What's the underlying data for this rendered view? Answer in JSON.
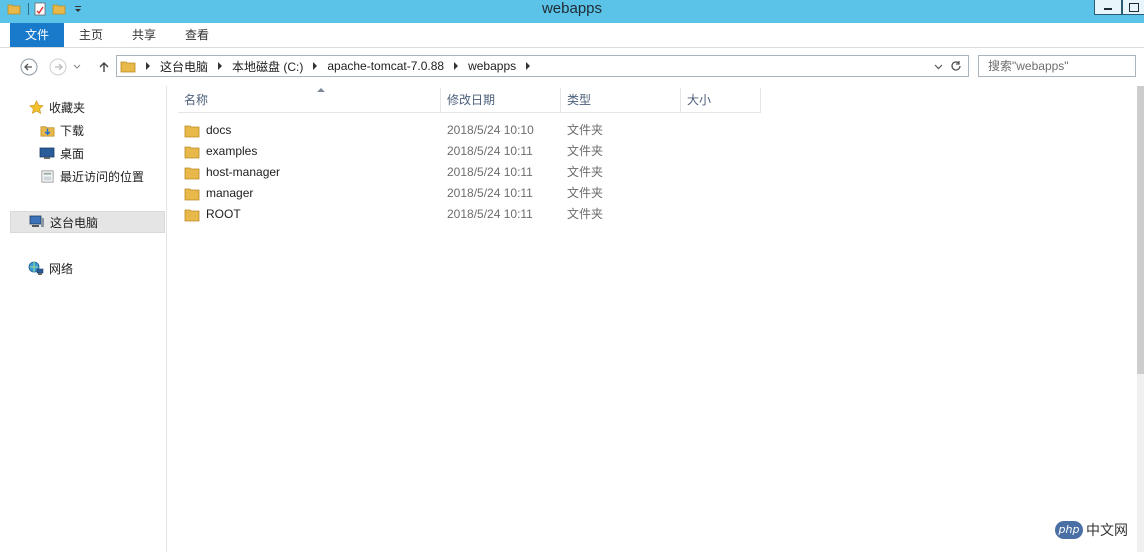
{
  "window": {
    "title": "webapps"
  },
  "ribbon": {
    "tabs": [
      "文件",
      "主页",
      "共享",
      "查看"
    ]
  },
  "address": {
    "crumbs": [
      "这台电脑",
      "本地磁盘 (C:)",
      "apache-tomcat-7.0.88",
      "webapps"
    ],
    "search_placeholder": "搜索\"webapps\""
  },
  "navpane": {
    "favorites_label": "收藏夹",
    "favorites": [
      "下载",
      "桌面",
      "最近访问的位置"
    ],
    "this_pc": "这台电脑",
    "network": "网络"
  },
  "columns": [
    "名称",
    "修改日期",
    "类型",
    "大小"
  ],
  "files": [
    {
      "name": "docs",
      "date": "2018/5/24 10:10",
      "type": "文件夹"
    },
    {
      "name": "examples",
      "date": "2018/5/24 10:11",
      "type": "文件夹"
    },
    {
      "name": "host-manager",
      "date": "2018/5/24 10:11",
      "type": "文件夹"
    },
    {
      "name": "manager",
      "date": "2018/5/24 10:11",
      "type": "文件夹"
    },
    {
      "name": "ROOT",
      "date": "2018/5/24 10:11",
      "type": "文件夹"
    }
  ],
  "watermark": {
    "badge": "php",
    "text": "中文网"
  },
  "colors": {
    "titlebar": "#5bc3e8",
    "file_tab": "#1979ca",
    "folder": "#e8b94a"
  },
  "icons": {
    "folder": "folder-icon",
    "star": "star-icon",
    "computer": "computer-icon",
    "network": "network-icon"
  }
}
